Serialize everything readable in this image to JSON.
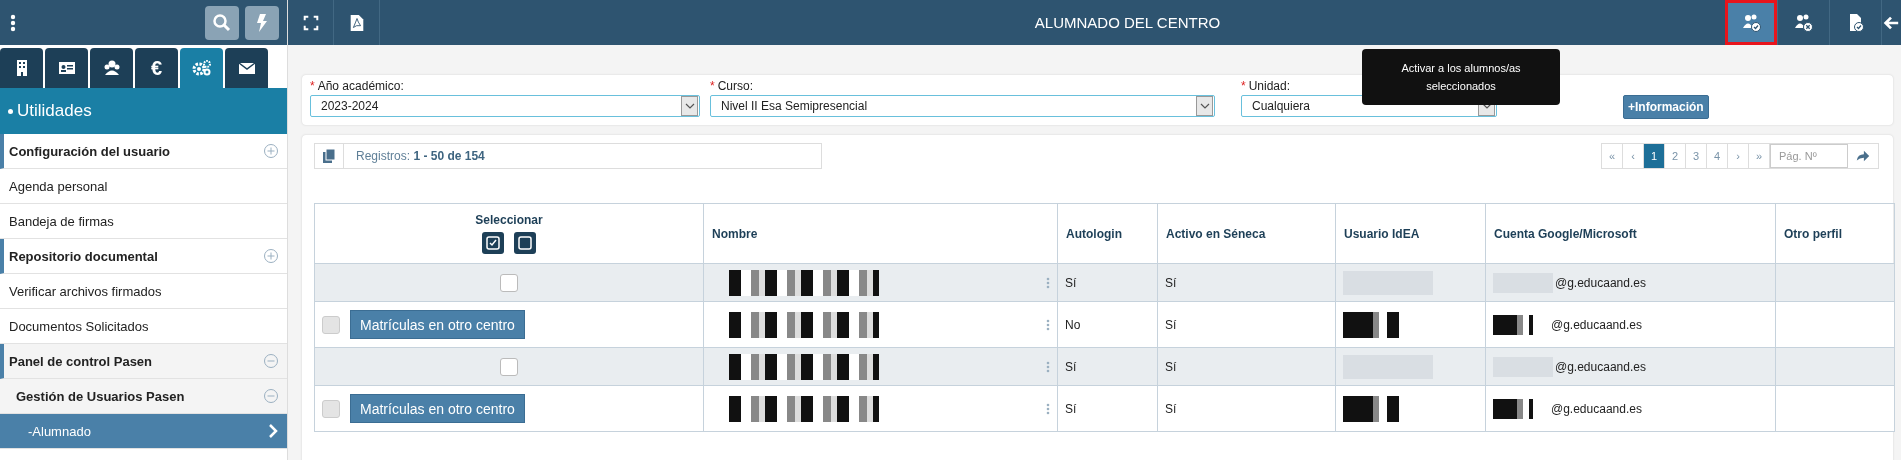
{
  "sidebar": {
    "tabs": [
      {
        "selected": false
      },
      {
        "selected": false
      },
      {
        "selected": false
      },
      {
        "text": "€",
        "selected": false
      },
      {
        "selected": true
      },
      {
        "selected": false
      }
    ],
    "section_title": "Utilidades",
    "items": [
      {
        "label": "Configuración del usuario",
        "kind": "group",
        "expanded": false
      },
      {
        "label": "Agenda personal",
        "kind": "link",
        "selected": false
      },
      {
        "label": "Bandeja de firmas",
        "kind": "link",
        "selected": false
      },
      {
        "label": "Repositorio documental",
        "kind": "group",
        "expanded": false
      },
      {
        "label": "Verificar archivos firmados",
        "kind": "link",
        "selected": false
      },
      {
        "label": "Documentos Solicitados",
        "kind": "link",
        "selected": false
      },
      {
        "label": "Panel de control Pasen",
        "kind": "group",
        "expanded": true,
        "children": [
          {
            "label": "Gestión de Usuarios Pasen",
            "kind": "group",
            "expanded": true,
            "children": [
              {
                "label": "-Alumnado",
                "kind": "link",
                "selected": true
              }
            ]
          }
        ]
      }
    ]
  },
  "window": {
    "title": "ALUMNADO DEL CENTRO",
    "actions": [
      {
        "highlighted": true
      },
      {
        "highlighted": false
      },
      {
        "highlighted": false
      }
    ],
    "tooltip": "Activar a los alumnos/as seleccionados"
  },
  "filters": [
    {
      "required_mark": "*",
      "label": "Año académico:",
      "value": "2023-2024"
    },
    {
      "required_mark": "*",
      "label": "Curso:",
      "value": "Nivel II Esa Semipresencial"
    },
    {
      "required_mark": "*",
      "label": "Unidad:",
      "value": "Cualquiera"
    }
  ],
  "info_button": {
    "icon": "+",
    "label": "Información"
  },
  "records": {
    "label": "Registros:",
    "range": "1 - 50 de 154"
  },
  "pagination": {
    "first": "«",
    "prev": "‹",
    "pages": [
      {
        "label": "1",
        "selected": true
      },
      {
        "label": "2",
        "selected": false
      },
      {
        "label": "3",
        "selected": false
      },
      {
        "label": "4",
        "selected": false
      }
    ],
    "next": "›",
    "last": "»",
    "placeholder": "Pág. Nº"
  },
  "table": {
    "select_header": "Seleccionar",
    "columns": [
      "Nombre",
      "Autologin",
      "Activo en Séneca",
      "Usuario IdEA",
      "Cuenta Google/Microsoft",
      "Otro perfil"
    ],
    "rows": [
      {
        "kind": "checkbox",
        "checked": false,
        "disabled": false,
        "autologin": "Sí",
        "active": "Sí",
        "account": "@g.educaand.es"
      },
      {
        "kind": "transfer",
        "checked": false,
        "disabled": true,
        "action": "Matrículas en otro centro",
        "autologin": "No",
        "active": "Sí",
        "account": "@g.educaand.es"
      },
      {
        "kind": "checkbox",
        "checked": false,
        "disabled": false,
        "autologin": "Sí",
        "active": "Sí",
        "account": "@g.educaand.es"
      },
      {
        "kind": "transfer",
        "checked": false,
        "disabled": true,
        "action": "Matrículas en otro centro",
        "autologin": "Sí",
        "active": "Sí",
        "account": "@g.educaand.es"
      }
    ]
  }
}
